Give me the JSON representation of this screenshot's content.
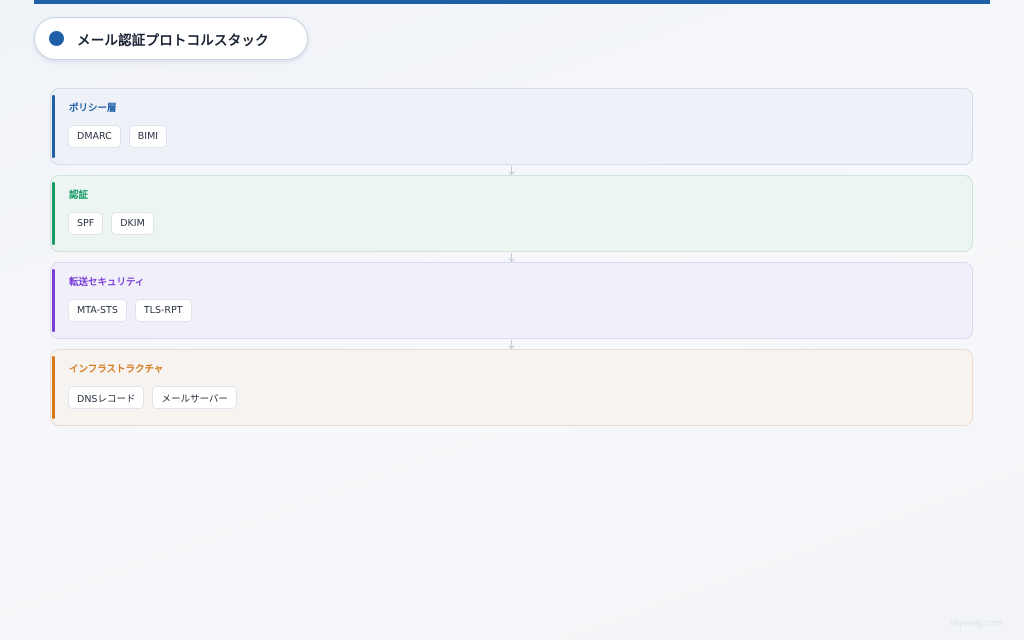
{
  "title": "メール認証プロトコルスタック",
  "layers": [
    {
      "title": "ポリシー層",
      "color": "#1f5fa8",
      "background": "#eef2f8",
      "border": "#d3dbe7",
      "items": [
        "DMARC",
        "BIMI"
      ]
    },
    {
      "title": "認証",
      "color": "#179a63",
      "background": "#ecf5f2",
      "border": "#cfe3db",
      "items": [
        "SPF",
        "DKIM"
      ]
    },
    {
      "title": "転送セキュリティ",
      "color": "#7b3fd8",
      "background": "#f1f0fa",
      "border": "#dcd8ee",
      "items": [
        "MTA-STS",
        "TLS-RPT"
      ]
    },
    {
      "title": "インフラストラクチャ",
      "color": "#d5791a",
      "background": "#f6f3f0",
      "border": "#ecdcce",
      "items": [
        "DNSレコード",
        "メールサーバー"
      ]
    }
  ],
  "watermark": "skyvsag.com"
}
